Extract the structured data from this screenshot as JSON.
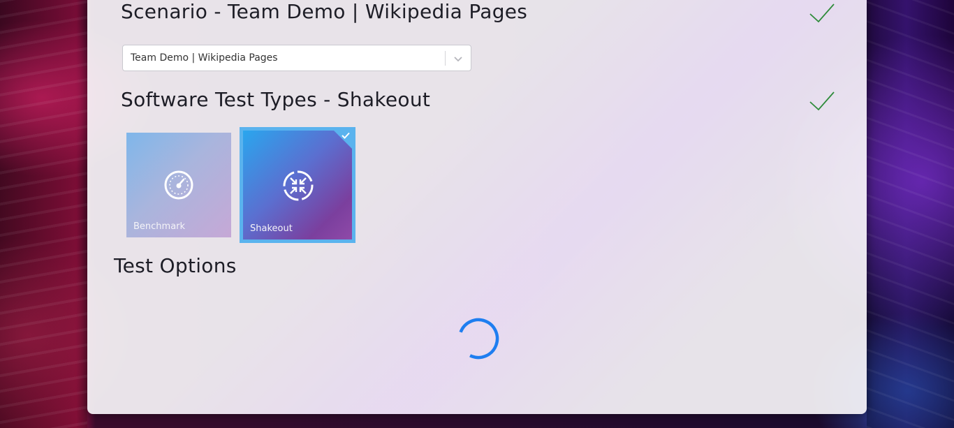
{
  "scenario": {
    "title": "Scenario - Team Demo | Wikipedia Pages",
    "select_value": "Team Demo | Wikipedia Pages",
    "complete_icon": "checkmark-icon"
  },
  "test_types": {
    "title": "Software Test Types - Shakeout",
    "complete_icon": "checkmark-icon",
    "tiles": [
      {
        "label": "Benchmark",
        "icon": "speedometer-icon",
        "selected": false
      },
      {
        "label": "Shakeout",
        "icon": "shrink-arrows-icon",
        "selected": true
      }
    ]
  },
  "test_options": {
    "title": "Test Options",
    "loading_icon": "spinner-icon"
  },
  "colors": {
    "accent": "#5ab3ee",
    "check_green": "#2e8b3a",
    "spinner_blue": "#1e7ef0"
  }
}
